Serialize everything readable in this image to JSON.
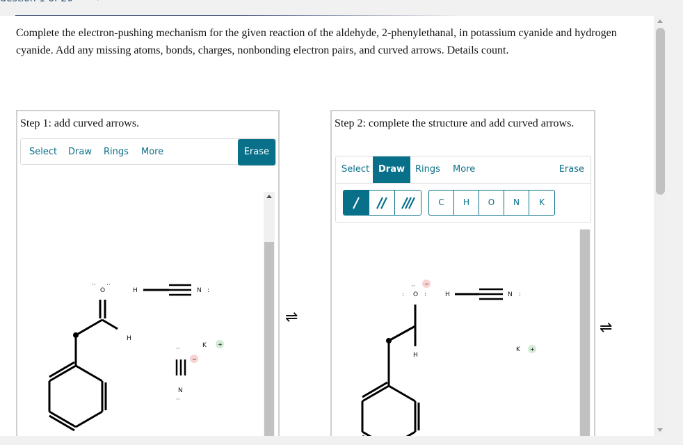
{
  "nav": {
    "question_label": "uestion 1 of 20",
    "next_icon": "chevron-right-icon"
  },
  "question": {
    "text": "Complete the electron-pushing mechanism for the given reaction of the aldehyde, 2-phenylethanal, in potassium cyanide and hydrogen cyanide. Add any missing atoms, bonds, charges, nonbonding electron pairs, and curved arrows. Details count."
  },
  "step1": {
    "title": "Step 1: add curved arrows.",
    "toolbar": {
      "tabs": [
        "Select",
        "Draw",
        "Rings",
        "More"
      ],
      "active_tab": "",
      "erase_label": "Erase"
    },
    "atoms": {
      "o_label": "O",
      "h_aldehyde": "H",
      "hcn_h": "H",
      "hcn_n": "N",
      "hcn_n_lp": ":",
      "k_label": "K",
      "k_charge": "+",
      "cn_n": "N",
      "cn_charge": "−",
      "lone_pair": "··"
    }
  },
  "step2": {
    "title": "Step 2: complete the structure and add curved arrows.",
    "toolbar": {
      "tabs": [
        "Select",
        "Draw",
        "Rings",
        "More"
      ],
      "active_tab": "Draw",
      "erase_label": "Erase",
      "bond_buttons": [
        "single-bond",
        "double-bond",
        "triple-bond"
      ],
      "active_bond": "single-bond",
      "atom_buttons": [
        "C",
        "H",
        "O",
        "N",
        "K"
      ]
    },
    "atoms": {
      "o_label": "O",
      "o_charge": "−",
      "o_lp_side": ":",
      "h_lower": "H",
      "hcn_h": "H",
      "hcn_n": "N",
      "hcn_n_lp": ":",
      "k_label": "K",
      "k_charge": "+",
      "lone_pair": "··"
    }
  },
  "equilibrium_arrow": "⇌",
  "colors": {
    "accent": "#087089",
    "negative_charge_bg": "#f9d2d2",
    "positive_charge_bg": "#d4ecd4"
  }
}
